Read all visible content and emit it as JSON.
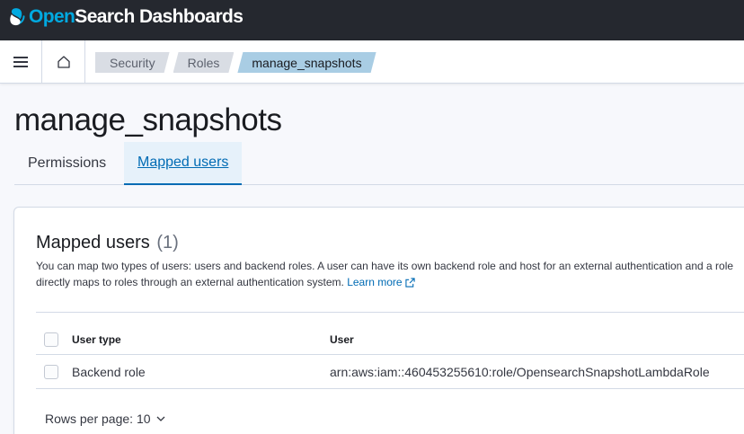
{
  "app": {
    "logo_open": "Open",
    "logo_rest": "Search Dashboards"
  },
  "breadcrumbs": [
    "Security",
    "Roles",
    "manage_snapshots"
  ],
  "page": {
    "title": "manage_snapshots"
  },
  "tabs": [
    {
      "label": "Permissions",
      "active": false
    },
    {
      "label": "Mapped users",
      "active": true
    }
  ],
  "mapped_users": {
    "title": "Mapped users",
    "count": "(1)",
    "description": "You can map two types of users: users and backend roles. A user can have its own backend role and host for an external authentication and a role directly maps to roles through an external authentication system.",
    "learn_more": "Learn more",
    "columns": [
      "User type",
      "User"
    ],
    "rows": [
      {
        "type": "Backend role",
        "user": "arn:aws:iam::460453255610:role/OpensearchSnapshotLambdaRole"
      }
    ],
    "rows_per_page": "Rows per page: 10"
  },
  "colors": {
    "header_bg": "#25282f",
    "logo_accent": "#01a9e0",
    "link": "#006bb4",
    "active_crumb": "#a9cde4"
  },
  "icons": [
    "opensearch-logo-icon",
    "menu-icon",
    "home-icon",
    "external-link-icon",
    "chevron-down-icon"
  ]
}
